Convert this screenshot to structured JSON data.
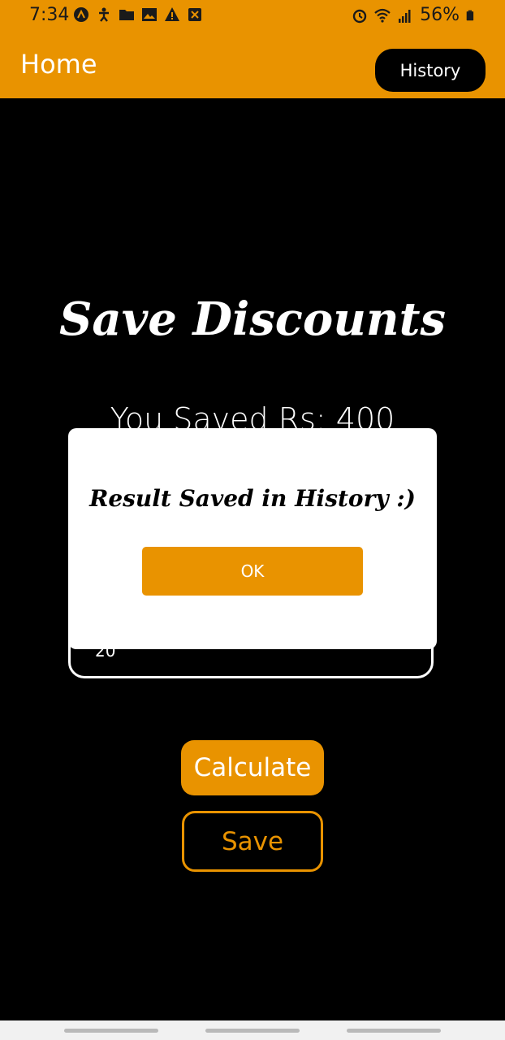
{
  "status_bar": {
    "time": "7:34",
    "battery": "56%",
    "icons_left": [
      "expo-icon",
      "accessibility-icon",
      "folder-icon",
      "image-icon",
      "warning-icon",
      "close-box-icon"
    ],
    "icons_right": [
      "alarm-icon",
      "wifi-icon",
      "signal-icon",
      "battery-icon"
    ]
  },
  "app_bar": {
    "title": "Home",
    "history_label": "History"
  },
  "main": {
    "title": "Save Discounts",
    "saved_text": "You Saved  Rs: 400",
    "input_value": "20",
    "calculate_label": "Calculate",
    "save_label": "Save"
  },
  "dialog": {
    "message": "Result Saved in History :)",
    "ok_label": "OK"
  },
  "colors": {
    "accent": "#E99300",
    "background": "#000000",
    "dialog": "#FFFFFF"
  }
}
